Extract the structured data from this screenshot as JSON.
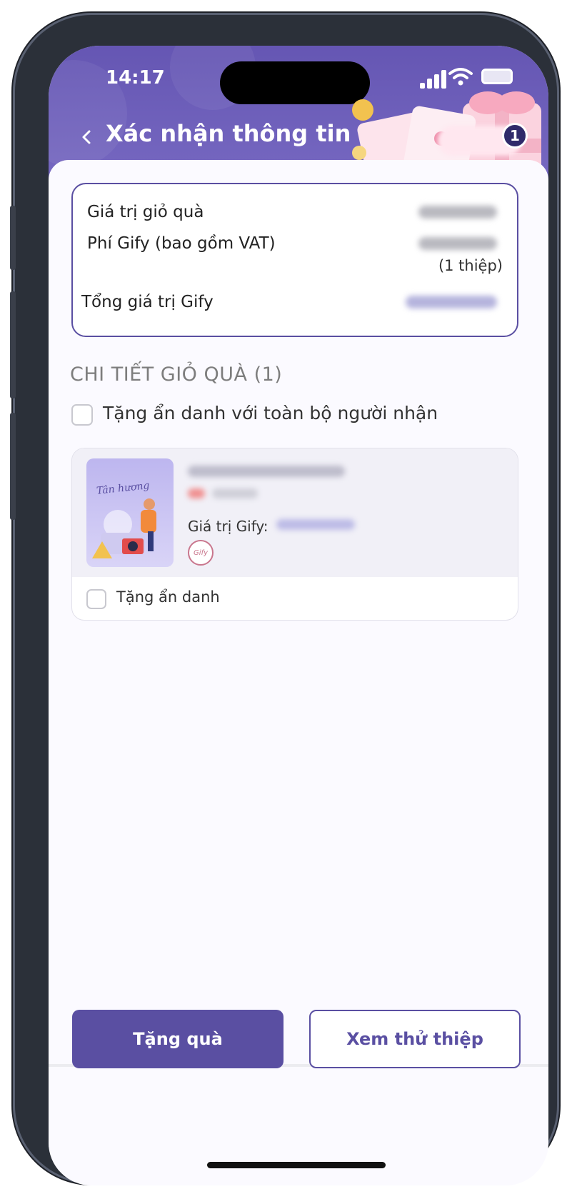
{
  "status_bar": {
    "time": "14:17"
  },
  "header": {
    "title": "Xác nhận thông tin",
    "cart_count": "1"
  },
  "summary": {
    "gift_value_label": "Giá trị giỏ quà",
    "fee_label": "Phí Gify (bao gồm VAT)",
    "card_count": "(1 thiệp)",
    "total_label": "Tổng giá trị Gify"
  },
  "details": {
    "section_title": "CHI TIẾT GIỎ QUÀ (1)",
    "anonymous_all_label": "Tặng ẩn danh với toàn bộ người nhận",
    "item": {
      "thumb_text": "Tân hương",
      "value_label": "Giá trị Gify:",
      "stamp_text": "Gify",
      "anonymous_label": "Tặng ẩn danh"
    }
  },
  "actions": {
    "gift_button": "Tặng quà",
    "preview_button": "Xem thử thiệp"
  },
  "colors": {
    "brand": "#5a4fa2",
    "header": "#6556b3"
  }
}
